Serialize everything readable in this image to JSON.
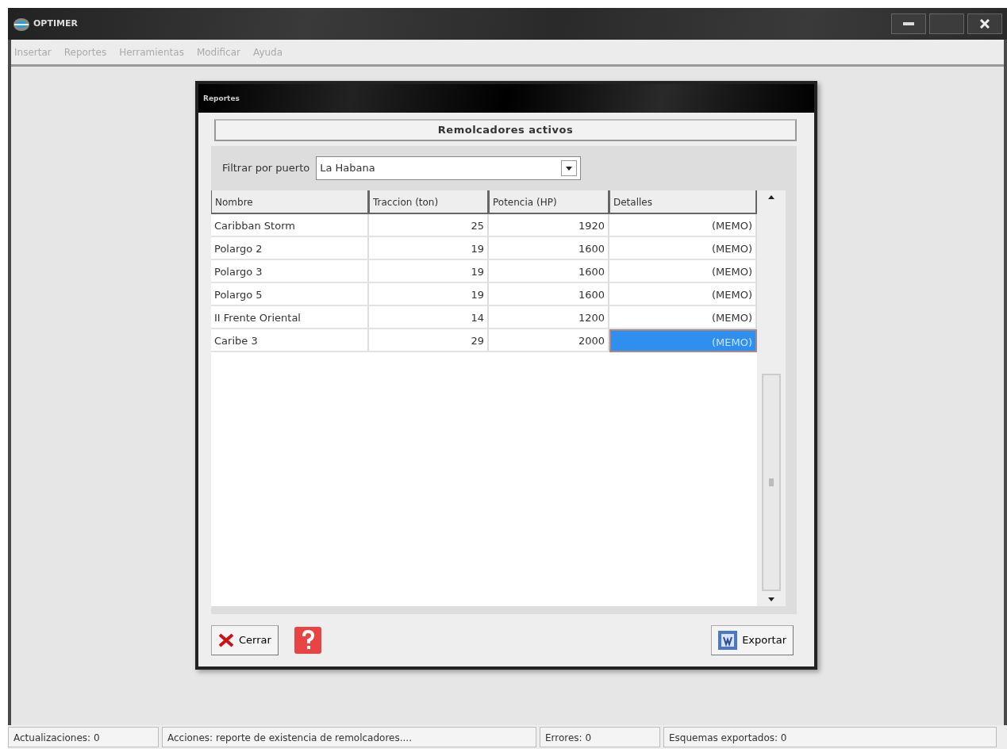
{
  "window": {
    "title": "OPTIMER"
  },
  "menu": [
    "Insertar",
    "Reportes",
    "Herramientas",
    "Modificar",
    "Ayuda"
  ],
  "dialog": {
    "title": "Reportes",
    "heading": "Remolcadores activos",
    "filter": {
      "label": "Filtrar por puerto",
      "value": "La Habana"
    },
    "table": {
      "columns": [
        "Nombre",
        "Traccion (ton)",
        "Potencia (HP)",
        "Detalles"
      ],
      "rows": [
        {
          "cells": [
            "Caribban Storm",
            "25",
            "1920",
            "(MEMO)"
          ],
          "selected": false
        },
        {
          "cells": [
            "Polargo 2",
            "19",
            "1600",
            "(MEMO)"
          ],
          "selected": false
        },
        {
          "cells": [
            "Polargo 3",
            "19",
            "1600",
            "(MEMO)"
          ],
          "selected": false
        },
        {
          "cells": [
            "Polargo 5",
            "19",
            "1600",
            "(MEMO)"
          ],
          "selected": false
        },
        {
          "cells": [
            "II Frente Oriental",
            "14",
            "1200",
            "(MEMO)"
          ],
          "selected": false
        },
        {
          "cells": [
            "Caribe 3",
            "29",
            "2000",
            "(MEMO)"
          ],
          "selected": true
        }
      ]
    },
    "buttons": {
      "close": "Cerrar",
      "export": "Exportar"
    }
  },
  "status_bar": [
    "Actualizaciones: 0",
    "Acciones: reporte de existencia de remolcadores....",
    "Errores: 0",
    "Esquemas exportados: 0"
  ]
}
